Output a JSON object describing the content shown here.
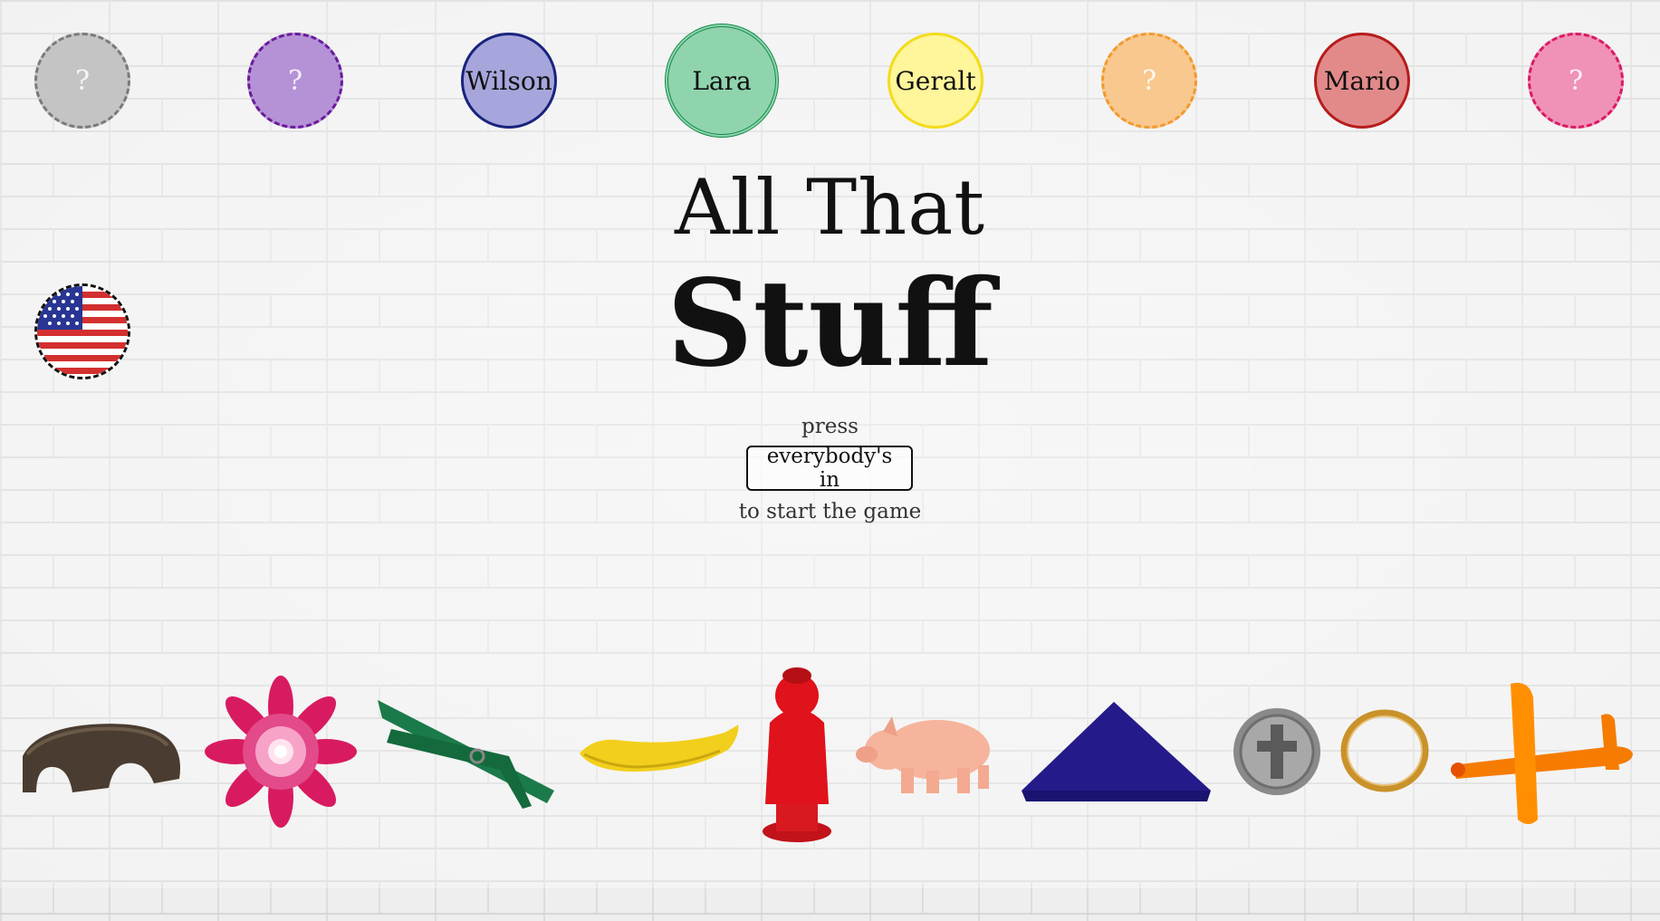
{
  "players": [
    {
      "label": "?",
      "color": "#c4c4c4",
      "border": "#7a7a7a",
      "state": "empty"
    },
    {
      "label": "?",
      "color": "#b592d6",
      "border": "#6a1b9a",
      "state": "empty"
    },
    {
      "label": "Wilson",
      "color": "#a6a6dc",
      "border": "#1a237e",
      "state": "filled"
    },
    {
      "label": "Lara",
      "color": "#8fd4ad",
      "border": "#138a4a",
      "state": "active"
    },
    {
      "label": "Geralt",
      "color": "#fff59a",
      "border": "#f2dc1c",
      "state": "filled"
    },
    {
      "label": "?",
      "color": "#f9c88e",
      "border": "#f29a2e",
      "state": "empty"
    },
    {
      "label": "Mario",
      "color": "#e28a8a",
      "border": "#b71c1c",
      "state": "filled"
    },
    {
      "label": "?",
      "color": "#f091b8",
      "border": "#d81b60",
      "state": "empty"
    }
  ],
  "language_flag": "us-flag-icon",
  "title": {
    "line1": "All That",
    "line2": "Stuff"
  },
  "instructions": {
    "press": "press",
    "button": "everybody's in",
    "after": "to start the game"
  },
  "objects": [
    "violin-mute",
    "pink-flower",
    "green-clothespin",
    "banana",
    "red-figurine",
    "pig-figurine",
    "blue-triangle",
    "cross-coin",
    "gold-ring",
    "orange-airplane"
  ]
}
